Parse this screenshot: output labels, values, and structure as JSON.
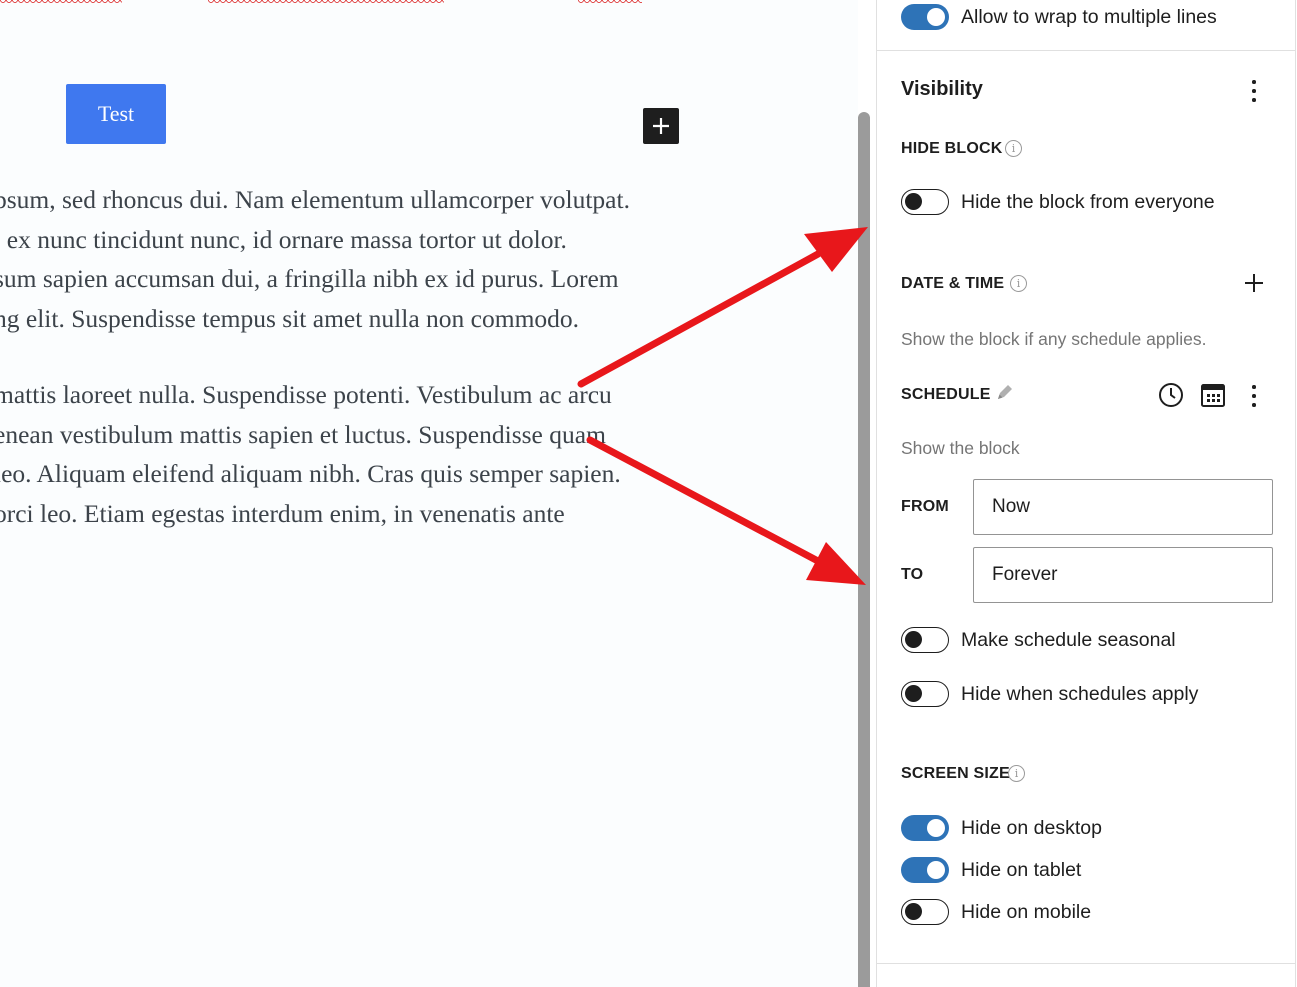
{
  "editor": {
    "button_label": "Test",
    "add_block_symbol": "+",
    "paragraph1": [
      "psum, sed rhoncus dui. Nam elementum ullamcorper volutpat.",
      ", ex nunc tincidunt nunc, id ornare massa tortor ut dolor.",
      "sum sapien accumsan dui, a fringilla nibh ex id purus. Lorem",
      "ng elit. Suspendisse tempus sit amet nulla non commodo."
    ],
    "paragraph2": [
      " mattis laoreet nulla. Suspendisse potenti. Vestibulum ac arcu",
      "enean vestibulum mattis sapien et luctus. Suspendisse quam",
      " leo. Aliquam eleifend aliquam nibh. Cras quis semper sapien.",
      "orci leo. Etiam egestas interdum enim, in venenatis ante"
    ],
    "annotation_color": "#e8171b"
  },
  "sidebar": {
    "wrap_toggle": {
      "label": "Allow to wrap to multiple lines",
      "on": true
    },
    "visibility": {
      "title": "Visibility",
      "hide_block": {
        "heading": "HIDE BLOCK",
        "toggle_label": "Hide the block from everyone",
        "on": false
      },
      "date_time": {
        "heading": "DATE & TIME",
        "add_symbol": "+",
        "description": "Show the block if any schedule applies."
      },
      "schedule": {
        "heading": "SCHEDULE",
        "description": "Show the block",
        "from_label": "FROM",
        "from_value": "Now",
        "to_label": "TO",
        "to_value": "Forever",
        "seasonal_label": "Make schedule seasonal",
        "seasonal_on": false,
        "hide_when_label": "Hide when schedules apply",
        "hide_when_on": false
      },
      "screen_size": {
        "heading": "SCREEN SIZE",
        "desktop_label": "Hide on desktop",
        "desktop_on": true,
        "tablet_label": "Hide on tablet",
        "tablet_on": true,
        "mobile_label": "Hide on mobile",
        "mobile_on": false
      }
    },
    "info_glyph": "i",
    "accent_color": "#2e73b7"
  }
}
